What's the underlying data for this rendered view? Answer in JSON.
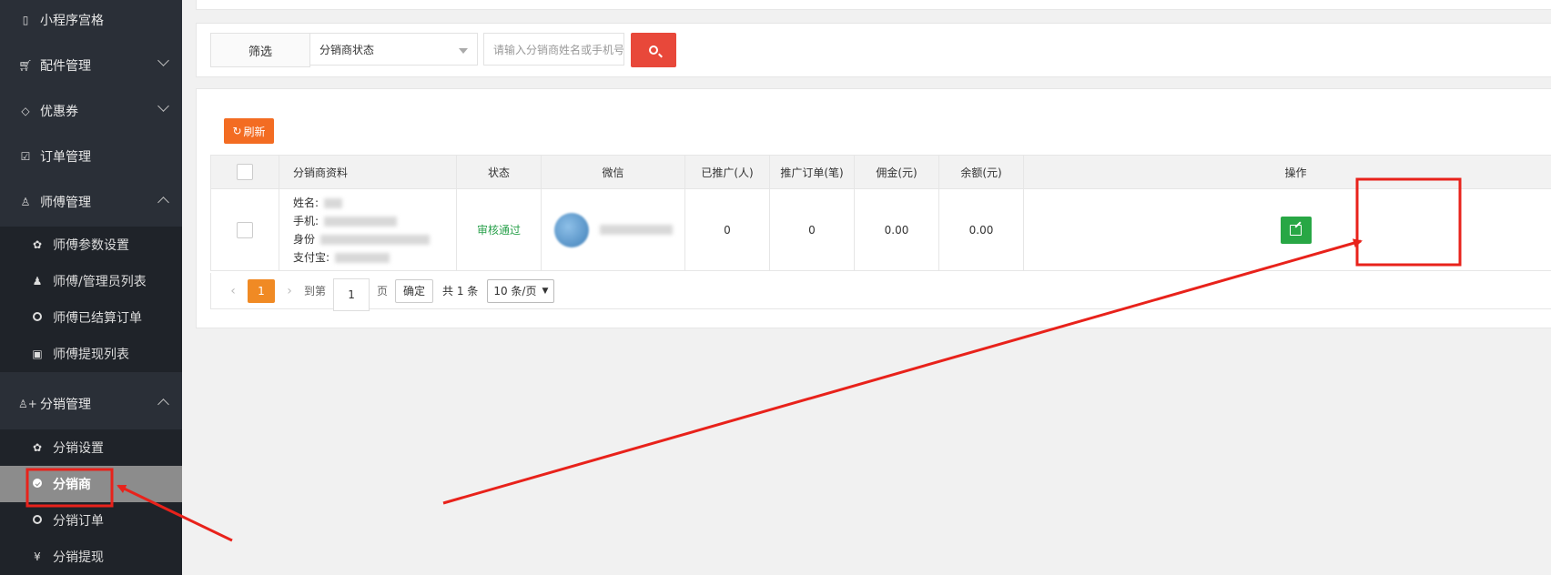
{
  "sidebar": {
    "items": [
      {
        "label": "小程序宫格",
        "icon": "mobile-icon"
      },
      {
        "label": "配件管理",
        "icon": "cart-icon"
      },
      {
        "label": "优惠券",
        "icon": "diamond-icon"
      },
      {
        "label": "订单管理",
        "icon": "check-square-icon"
      },
      {
        "label": "师傅管理",
        "icon": "worker-icon"
      },
      {
        "label": "分销管理",
        "icon": "user-plus-icon"
      }
    ],
    "master_sub": [
      {
        "label": "师傅参数设置",
        "icon": "gear-icon"
      },
      {
        "label": "师傅/管理员列表",
        "icon": "users-icon"
      },
      {
        "label": "师傅已结算订单",
        "icon": "check-circle-icon"
      },
      {
        "label": "师傅提现列表",
        "icon": "money-icon"
      }
    ],
    "dist_sub": [
      {
        "label": "分销设置",
        "icon": "gear-icon"
      },
      {
        "label": "分销商",
        "icon": "plus-circle-icon",
        "active": true
      },
      {
        "label": "分销订单",
        "icon": "check-circle-icon"
      },
      {
        "label": "分销提现",
        "icon": "yen-icon",
        "glyph": "¥"
      }
    ]
  },
  "filter": {
    "label": "筛选",
    "status_select": "分销商状态",
    "search_placeholder": "请输入分销商姓名或手机号"
  },
  "toolbar": {
    "refresh": "刷新"
  },
  "table": {
    "headers": [
      "分销商资料",
      "状态",
      "微信",
      "已推广(人)",
      "推广订单(笔)",
      "佣金(元)",
      "余额(元)",
      "操作"
    ],
    "rows": [
      {
        "info_labels": [
          "姓名:",
          "手机:",
          "身份",
          "支付宝:"
        ],
        "status": "审核通过",
        "promoted": "0",
        "orders": "0",
        "commission": "0.00",
        "balance": "0.00"
      }
    ]
  },
  "pagination": {
    "current": "1",
    "goto_label": "到第",
    "goto_value": "1",
    "page_unit": "页",
    "confirm": "确定",
    "total": "共 1 条",
    "page_size": "10 条/页"
  },
  "colors": {
    "sidebar_bg": "#2a2f37",
    "search_button": "#e8483a",
    "refresh_button": "#f36c22",
    "edit_button": "#28a745",
    "status_text": "#2aa14c",
    "annotation": "#e8221b"
  }
}
